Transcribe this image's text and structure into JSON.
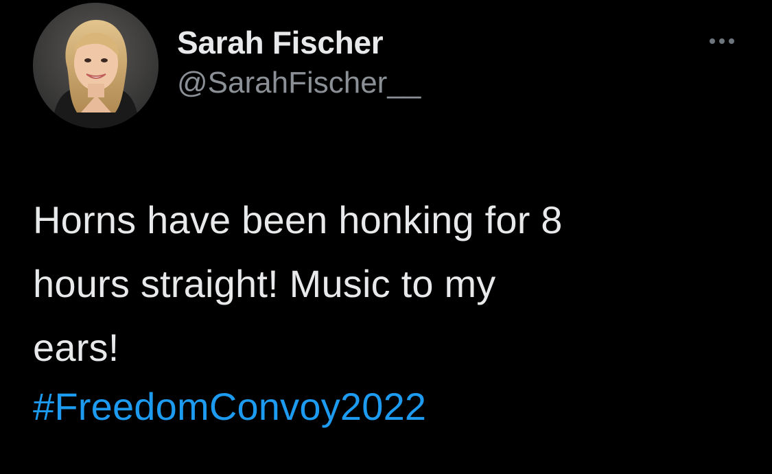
{
  "tweet": {
    "author": {
      "display_name": "Sarah Fischer",
      "handle": "@SarahFischer__",
      "avatar_icon": "profile-photo"
    },
    "more_icon": "more-horizontal-icon",
    "text": "Horns have been honking for 8\nhours straight! Music to my\nears!",
    "hashtag": "#FreedomConvoy2022"
  },
  "colors": {
    "background": "#000000",
    "text": "#e7e9ea",
    "secondary": "#8b9096",
    "link": "#1d9bf0"
  }
}
